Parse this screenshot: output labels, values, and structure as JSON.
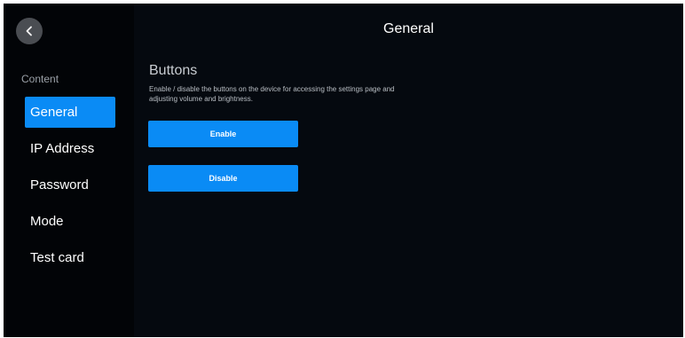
{
  "header": {
    "title": "General",
    "back_icon": "chevron-left-icon"
  },
  "sidebar": {
    "section_label": "Content",
    "items": [
      {
        "label": "General",
        "active": true
      },
      {
        "label": "IP Address",
        "active": false
      },
      {
        "label": "Password",
        "active": false
      },
      {
        "label": "Mode",
        "active": false
      },
      {
        "label": "Test card",
        "active": false
      }
    ]
  },
  "main": {
    "group_title": "Buttons",
    "group_description": "Enable / disable the buttons on the device for accessing the settings page and adjusting volume and brightness.",
    "enable_label": "Enable",
    "disable_label": "Disable"
  },
  "colors": {
    "accent": "#0a8bf5",
    "background": "#05090f",
    "sidebar": "#020407"
  }
}
